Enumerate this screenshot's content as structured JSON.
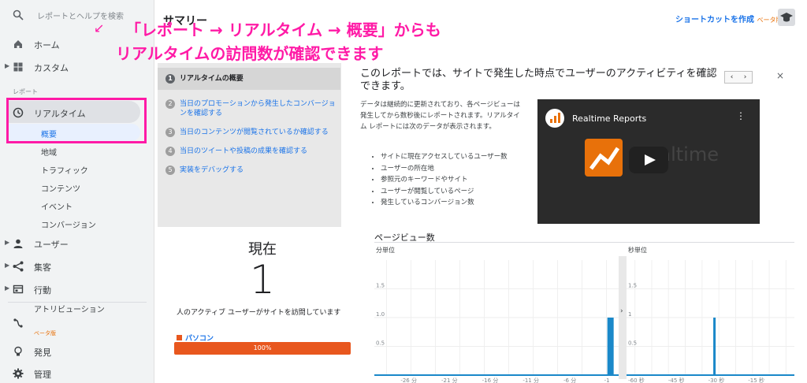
{
  "sidebar": {
    "search_placeholder": "レポートとヘルプを検索",
    "home": "ホーム",
    "custom": "カスタム",
    "reports_section": "レポート",
    "realtime": "リアルタイム",
    "sub_items": [
      "概要",
      "地域",
      "トラフィック",
      "コンテンツ",
      "イベント",
      "コンバージョン"
    ],
    "users": "ユーザー",
    "acquisition": "集客",
    "behavior": "行動",
    "attribution": "アトリビューション",
    "attribution_beta": "ベータ版",
    "discover": "発見",
    "admin": "管理"
  },
  "header": {
    "page_title": "サマリー",
    "shortcut": "ショートカットを作成",
    "shortcut_beta": "ベータ版"
  },
  "annotation": {
    "line1": "「レポート → リアルタイム → 概要」からも",
    "line2": "リアルタイムの訪問数が確認できます",
    "arrow": "↙"
  },
  "help": {
    "steps": [
      {
        "num": "1",
        "label": "リアルタイムの概要"
      },
      {
        "num": "2",
        "label": "当日のプロモーションから発生したコンバージョンを確認する"
      },
      {
        "num": "3",
        "label": "当日のコンテンツが閲覧されているか確認する"
      },
      {
        "num": "4",
        "label": "当日のツイートや投稿の成果を確認する"
      },
      {
        "num": "5",
        "label": "実装をデバッグする"
      }
    ],
    "heading": "このレポートでは、サイトで発生した時点でユーザーのアクティビティを確認できます。",
    "body": "データは継続的に更新されており、各ページビューは発生してから数秒後にレポートされます。リアルタイム レポートには次のデータが表示されます。",
    "list": [
      "サイトに現在アクセスしているユーザー数",
      "ユーザーの所在地",
      "参照元のキーワードやサイト",
      "ユーザーが閲覧しているページ",
      "発生しているコンバージョン数"
    ],
    "prev": "‹",
    "next": "›",
    "close": "×",
    "video_title": "Realtime Reports",
    "video_overlay": "Realtime"
  },
  "now": {
    "title": "現在",
    "count": "1",
    "description": "人のアクティブ ユーザーがサイトを訪問しています",
    "device_label": "パソコン",
    "device_percent": "100%"
  },
  "pageviews": {
    "title": "ページビュー数",
    "minute_label": "分単位",
    "second_label": "秒単位"
  },
  "chart_data": [
    {
      "type": "bar",
      "title": "分単位",
      "yticks": [
        "1.5",
        "1.0",
        "0.5"
      ],
      "xticks": [
        "-26 分",
        "-21 分",
        "-16 分",
        "-11 分",
        "-6 分",
        "-1"
      ],
      "ylim": [
        0,
        2
      ],
      "x": [
        -1
      ],
      "values": [
        1
      ]
    },
    {
      "type": "bar",
      "title": "秒単位",
      "yticks": [
        "1.5",
        "1",
        "0.5"
      ],
      "xticks": [
        "-60 秒",
        "-45 秒",
        "-30 秒",
        "-15 秒"
      ],
      "ylim": [
        0,
        2
      ],
      "x": [
        -30
      ],
      "values": [
        1
      ]
    }
  ],
  "colors": {
    "accent": "#1a73e8",
    "annotation": "#ff1aa6",
    "device_bar": "#e8571e",
    "chart_bar": "#1a88c9"
  }
}
